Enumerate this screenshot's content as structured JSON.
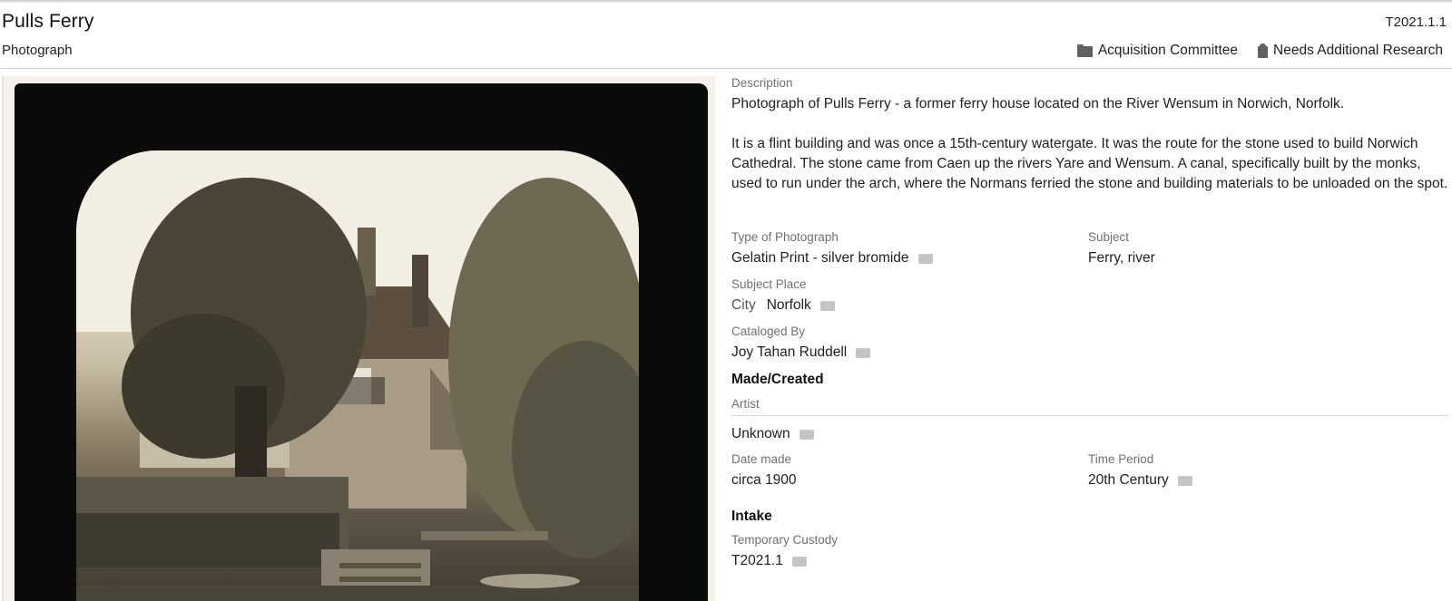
{
  "record": {
    "title": "Pulls Ferry",
    "object_type": "Photograph",
    "accession_number": "T2021.1.1",
    "tags": [
      {
        "label": "Acquisition Committee",
        "icon": "folder-icon"
      },
      {
        "label": "Needs Additional Research",
        "icon": "tag-icon"
      }
    ]
  },
  "description": {
    "label": "Description",
    "paragraph_1": "Photograph of Pulls Ferry - a former ferry house located on the River Wensum in Norwich, Norfolk.",
    "paragraph_2": "It is a flint building and was once a 15th-century watergate. It was the route for the stone used to build Norwich Cathedral. The stone came from Caen up the rivers Yare and Wensum. A canal, specifically built by the monks, used to run under the arch, where the Normans ferried the stone and building materials to be unloaded on the spot."
  },
  "fields": {
    "type_of_photograph": {
      "label": "Type of Photograph",
      "value": "Gelatin Print - silver bromide"
    },
    "subject": {
      "label": "Subject",
      "value": "Ferry, river"
    },
    "subject_place": {
      "label": "Subject Place",
      "prefix": "City",
      "value": "Norfolk"
    },
    "cataloged_by": {
      "label": "Cataloged By",
      "value": "Joy Tahan Ruddell"
    }
  },
  "made_created": {
    "heading": "Made/Created",
    "artist_label": "Artist",
    "artist_value": "Unknown",
    "date_made_label": "Date made",
    "date_made_value": "circa 1900",
    "time_period_label": "Time Period",
    "time_period_value": "20th Century"
  },
  "intake": {
    "heading": "Intake",
    "temporary_custody_label": "Temporary Custody",
    "temporary_custody_value": "T2021.1"
  },
  "colors": {
    "label_gray": "#707070",
    "text": "#1f1f1f",
    "icon_gray": "#616161",
    "note_button": "#c4c4c4"
  }
}
